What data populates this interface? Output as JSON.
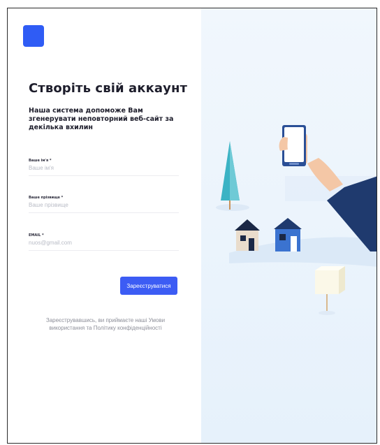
{
  "brand": {
    "logo_color": "#2f5cf5"
  },
  "form": {
    "title": "Створіть свій аккаунт",
    "subtitle": "Наша система допоможе Вам згенерувати неповторний веб-сайт за декілька вхилин",
    "fields": [
      {
        "label": "Ваше ім'я *",
        "placeholder": "Ваше ім'я",
        "value": ""
      },
      {
        "label": "Ваше прізвище *",
        "placeholder": "Ваше прізвище",
        "value": ""
      },
      {
        "label": "EMAIL *",
        "placeholder": "nuos@gmail.com",
        "value": ""
      }
    ],
    "submit_label": "Зареєструватися",
    "terms": "Зареєструвавшись, ви приймаєте наші Умови використання та Політику конфіденційності"
  },
  "colors": {
    "accent": "#3c5cf4",
    "panel_bg": "#eaf3fc",
    "sleeve": "#1f3a6e",
    "tree": "#3bb3c4"
  }
}
